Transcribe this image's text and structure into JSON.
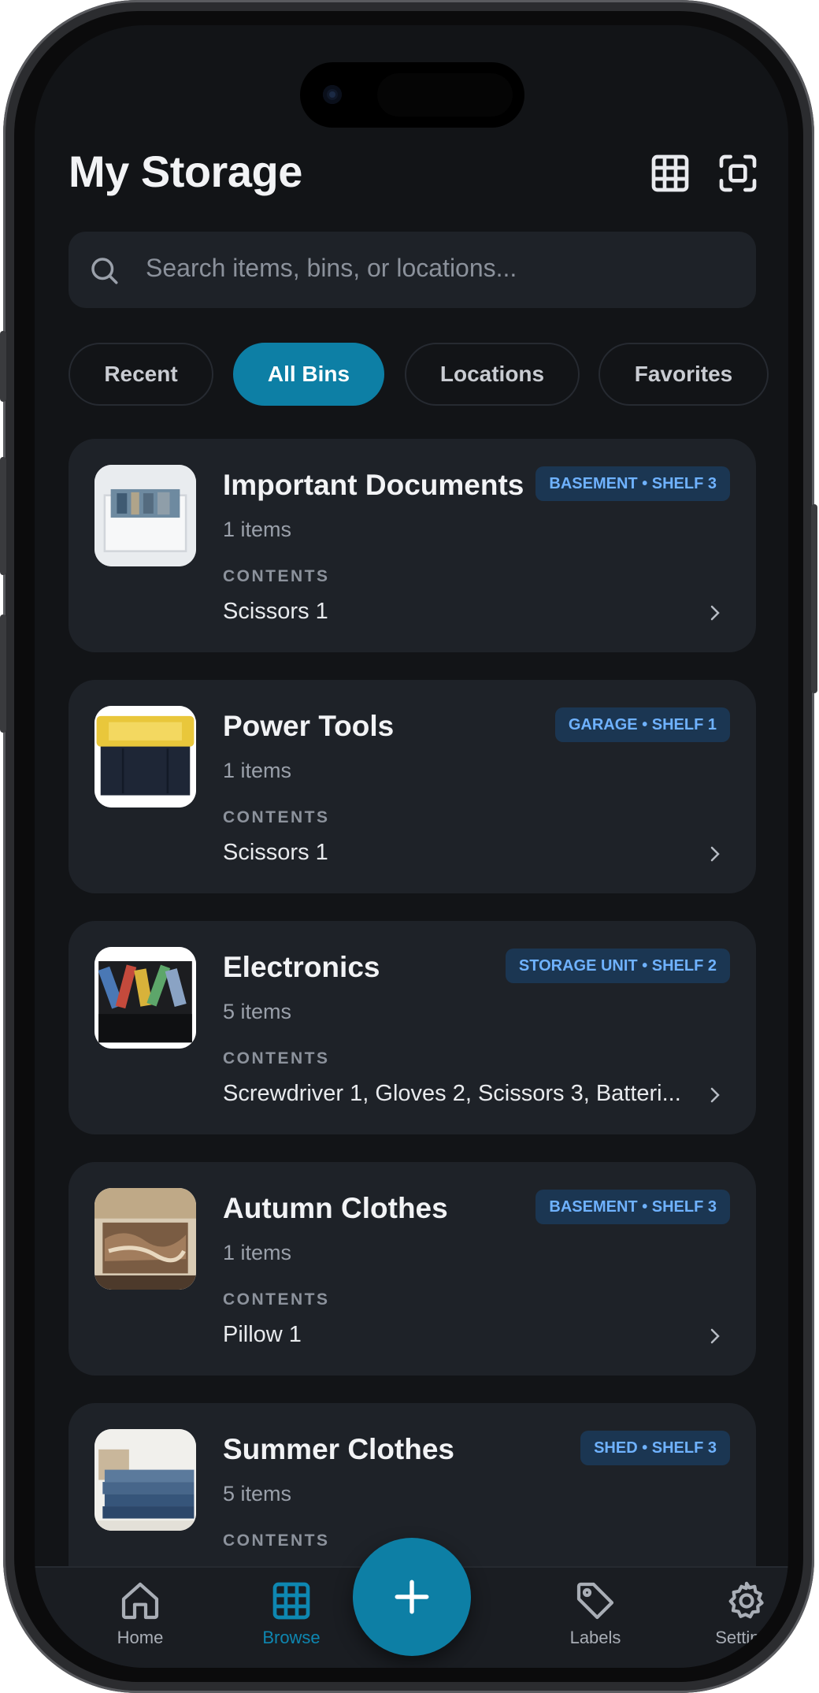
{
  "header": {
    "title": "My Storage",
    "grid_icon": "grid-icon",
    "scan_icon": "scan-icon"
  },
  "search": {
    "placeholder": "Search items, bins, or locations..."
  },
  "filters": [
    {
      "label": "Recent",
      "active": false
    },
    {
      "label": "All Bins",
      "active": true
    },
    {
      "label": "Locations",
      "active": false
    },
    {
      "label": "Favorites",
      "active": false
    }
  ],
  "bins": [
    {
      "name": "Important Documents",
      "count": "1 items",
      "location": "BASEMENT • SHELF 3",
      "contents_label": "CONTENTS",
      "contents": "Scissors 1"
    },
    {
      "name": "Power Tools",
      "count": "1 items",
      "location": "GARAGE • SHELF 1",
      "contents_label": "CONTENTS",
      "contents": "Scissors 1"
    },
    {
      "name": "Electronics",
      "count": "5 items",
      "location": "STORAGE UNIT • SHELF 2",
      "contents_label": "CONTENTS",
      "contents": "Screwdriver 1, Gloves 2, Scissors 3, Batteri..."
    },
    {
      "name": "Autumn Clothes",
      "count": "1 items",
      "location": "BASEMENT • SHELF 3",
      "contents_label": "CONTENTS",
      "contents": "Pillow 1"
    },
    {
      "name": "Summer Clothes",
      "count": "5 items",
      "location": "SHED • SHELF 3",
      "contents_label": "CONTENTS",
      "contents": ""
    }
  ],
  "tabs": [
    {
      "label": "Home",
      "icon": "home-icon",
      "active": false
    },
    {
      "label": "Browse",
      "icon": "grid-icon",
      "active": true
    },
    {
      "label": "Labels",
      "icon": "tag-icon",
      "active": false
    },
    {
      "label": "Settings",
      "icon": "gear-icon",
      "active": false
    }
  ],
  "fab": {
    "icon": "plus-icon"
  },
  "colors": {
    "accent": "#0d7fa5",
    "background": "#121417",
    "card": "#1e2228",
    "badge_bg": "#1b3652",
    "badge_text": "#6fb2ff"
  }
}
